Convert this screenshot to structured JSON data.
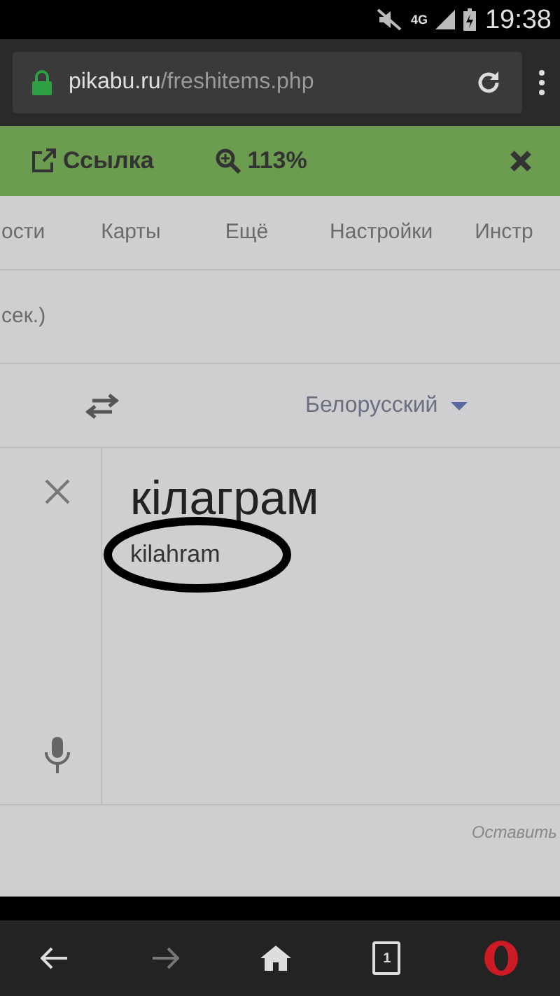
{
  "status_bar": {
    "network": "4G",
    "time": "19:38"
  },
  "address_bar": {
    "domain": "pikabu.ru",
    "path": "/freshitems.php"
  },
  "toolbar": {
    "link_label": "Ссылка",
    "zoom": "113%"
  },
  "page": {
    "nav_items": [
      "ости",
      "Карты",
      "Ещё",
      "Настройки",
      "Инстр"
    ],
    "hint": "сек.)",
    "target_language": "Белорусский",
    "translation": "кілаграм",
    "transliteration": "kilahram",
    "footer_link": "Оставить"
  },
  "bottom_nav": {
    "tab_count": "1"
  }
}
